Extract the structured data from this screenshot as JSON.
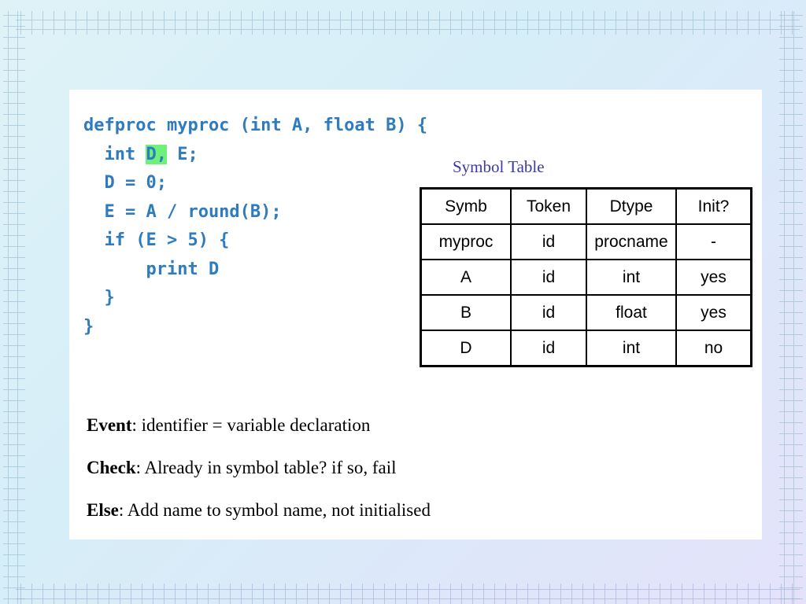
{
  "code": {
    "line1": "defproc myproc (int A, float B) {",
    "line2_pre": "  int ",
    "line2_highlight": "D,",
    "line2_post": " E;",
    "line3": "  D = 0;",
    "line4": "  E = A / round(B);",
    "line5": "  if (E > 5) {",
    "line6": "      print D",
    "line7": "  }",
    "line8": "}"
  },
  "colors": {
    "code": "#2e7bbf",
    "highlight": "#6ef07a",
    "table_title": "#3a3aa8"
  },
  "symbol_table": {
    "title": "Symbol Table",
    "headers": [
      "Symb",
      "Token",
      "Dtype",
      "Init?"
    ],
    "rows": [
      [
        "myproc",
        "id",
        "procname",
        "-"
      ],
      [
        "A",
        "id",
        "int",
        "yes"
      ],
      [
        "B",
        "id",
        "float",
        "yes"
      ],
      [
        "D",
        "id",
        "int",
        "no"
      ]
    ]
  },
  "notes": [
    {
      "label": "Event",
      "text": ": identifier = variable declaration"
    },
    {
      "label": "Check",
      "text": ": Already in symbol table? if so, fail"
    },
    {
      "label": "Else",
      "text": ": Add name to symbol name, not initialised"
    }
  ]
}
